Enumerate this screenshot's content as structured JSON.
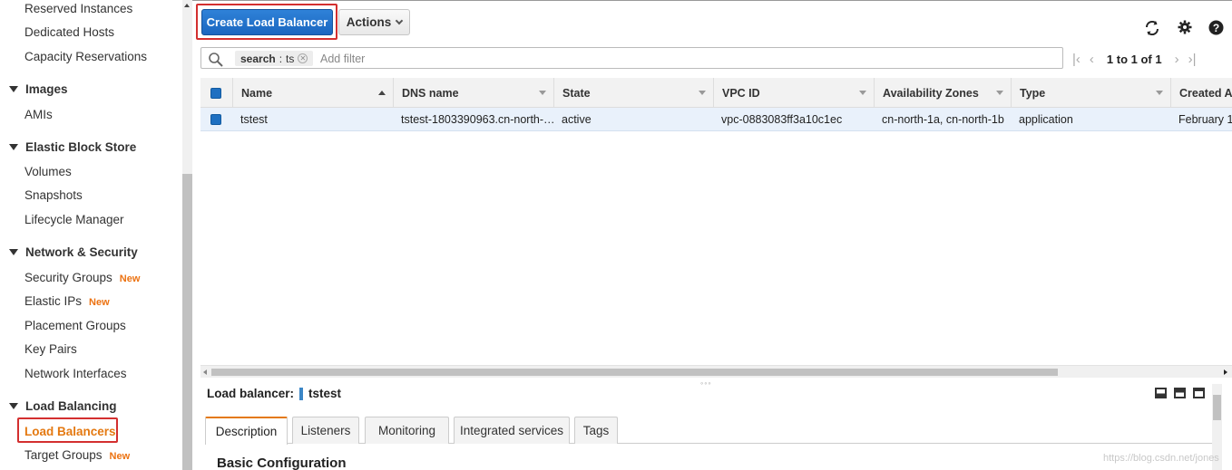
{
  "sidebar": {
    "items_top": [
      {
        "label": "Reserved Instances"
      },
      {
        "label": "Dedicated Hosts"
      },
      {
        "label": "Capacity Reservations"
      }
    ],
    "sections": [
      {
        "title": "Images",
        "items": [
          {
            "label": "AMIs"
          }
        ]
      },
      {
        "title": "Elastic Block Store",
        "items": [
          {
            "label": "Volumes"
          },
          {
            "label": "Snapshots"
          },
          {
            "label": "Lifecycle Manager"
          }
        ]
      },
      {
        "title": "Network & Security",
        "items": [
          {
            "label": "Security Groups",
            "badge": "New"
          },
          {
            "label": "Elastic IPs",
            "badge": "New"
          },
          {
            "label": "Placement Groups"
          },
          {
            "label": "Key Pairs"
          },
          {
            "label": "Network Interfaces"
          }
        ]
      },
      {
        "title": "Load Balancing",
        "items": [
          {
            "label": "Load Balancers",
            "active": true
          },
          {
            "label": "Target Groups",
            "badge": "New"
          }
        ]
      }
    ]
  },
  "toolbar": {
    "create_label": "Create Load Balancer",
    "actions_label": "Actions",
    "icons": [
      "refresh-icon",
      "gear-icon",
      "help-icon"
    ]
  },
  "filter": {
    "token_key": "search",
    "token_value": "ts",
    "placeholder": "Add filter"
  },
  "pager": {
    "text": "1 to 1 of 1"
  },
  "table": {
    "columns": [
      "Name",
      "DNS name",
      "State",
      "VPC ID",
      "Availability Zones",
      "Type",
      "Created A"
    ],
    "rows": [
      {
        "name": "tstest",
        "dns": "tstest-1803390963.cn-north-…",
        "state": "active",
        "vpc": "vpc-0883083ff3a10c1ec",
        "zones": "cn-north-1a, cn-north-1b",
        "type": "application",
        "created": "February 1"
      }
    ]
  },
  "detail": {
    "label": "Load balancer:",
    "value": "tstest",
    "tabs": [
      "Description",
      "Listeners",
      "Monitoring",
      "Integrated services",
      "Tags"
    ],
    "active_tab": "Description",
    "section_title": "Basic Configuration"
  },
  "watermark": "https://blog.csdn.net/jones",
  "colors": {
    "primary_button": "#1f6fc5",
    "active_nav": "#e47911",
    "new_badge": "#ec7211",
    "highlight_box": "#d32f2f",
    "selected_row": "#e9f1fb"
  }
}
